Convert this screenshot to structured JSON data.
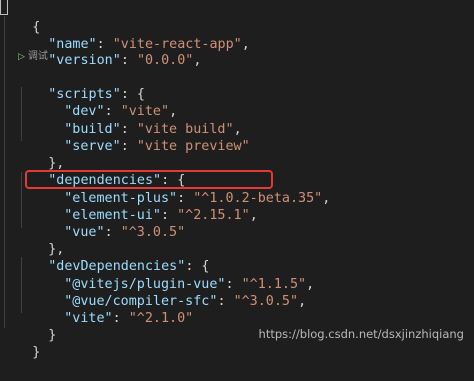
{
  "code": {
    "open_brace": "{",
    "name_key": "\"name\"",
    "name_val": "\"vite-react-app\"",
    "version_key": "\"version\"",
    "version_val": "\"0.0.0\"",
    "scripts_key": "\"scripts\"",
    "dev_key": "\"dev\"",
    "dev_val": "\"vite\"",
    "build_key": "\"build\"",
    "build_val": "\"vite build\"",
    "serve_key": "\"serve\"",
    "serve_val": "\"vite preview\"",
    "dependencies_key": "\"dependencies\"",
    "element_plus_key": "\"element-plus\"",
    "element_plus_val": "\"^1.0.2-beta.35\"",
    "element_ui_key": "\"element-ui\"",
    "element_ui_val": "\"^2.15.1\"",
    "vue_key": "\"vue\"",
    "vue_val": "\"^3.0.5\"",
    "dev_dependencies_key": "\"devDependencies\"",
    "plugin_vue_key": "\"@vitejs/plugin-vue\"",
    "plugin_vue_val": "\"^1.1.5\"",
    "compiler_sfc_key": "\"@vue/compiler-sfc\"",
    "compiler_sfc_val": "\"^3.0.5\"",
    "vite_key": "\"vite\"",
    "vite_val": "\"^2.1.0\"",
    "close_brace": "}"
  },
  "codelens": {
    "debug_label": "调试",
    "icon": "play-icon"
  },
  "watermark": "https://blog.csdn.net/dsxjinzhiqiang",
  "colors": {
    "background": "#1e1e1e",
    "key": "#9cdcfe",
    "string": "#ce9178",
    "highlight_border": "#e53935"
  }
}
